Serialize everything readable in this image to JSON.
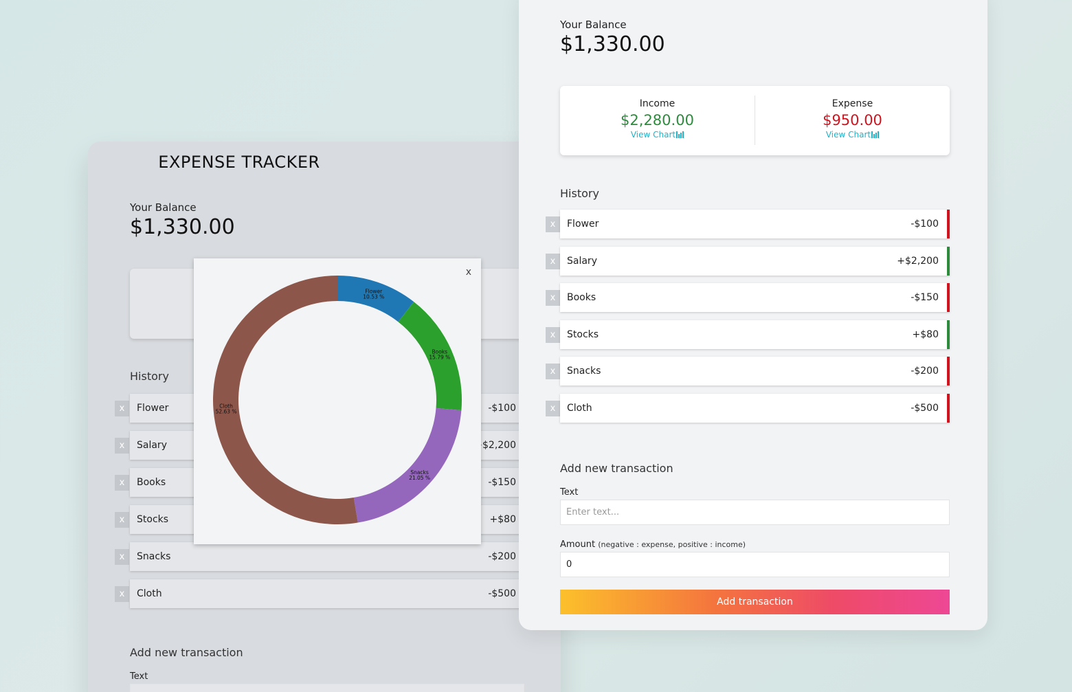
{
  "app_title": "EXPENSE TRACKER",
  "balance": {
    "label": "Your Balance",
    "value": "$1,330.00"
  },
  "income": {
    "label": "Income",
    "value": "$2,280.00",
    "link": "View Chart",
    "color": "#2e8b3e"
  },
  "expense": {
    "label": "Expense",
    "value": "$950.00",
    "link": "View Chart",
    "color": "#d0141f"
  },
  "history": {
    "title": "History",
    "delete_label": "x",
    "items": [
      {
        "text": "Flower",
        "amount": "-$100",
        "type": "expense"
      },
      {
        "text": "Salary",
        "amount": "+$2,200",
        "type": "income"
      },
      {
        "text": "Books",
        "amount": "-$150",
        "type": "expense"
      },
      {
        "text": "Stocks",
        "amount": "+$80",
        "type": "income"
      },
      {
        "text": "Snacks",
        "amount": "-$200",
        "type": "expense"
      },
      {
        "text": "Cloth",
        "amount": "-$500",
        "type": "expense"
      }
    ]
  },
  "form": {
    "title": "Add new transaction",
    "text_label": "Text",
    "text_placeholder": "Enter text...",
    "amount_label": "Amount",
    "amount_hint": "(negative : expense, positive : income)",
    "amount_value": "0",
    "submit_label": "Add transaction"
  },
  "popup": {
    "close_label": "x"
  },
  "chart_data": {
    "type": "pie",
    "donut": true,
    "categories": [
      "Flower",
      "Books",
      "Snacks",
      "Cloth"
    ],
    "values": [
      100,
      150,
      200,
      500
    ],
    "labels": [
      "10.53 %",
      "15.79 %",
      "21.05 %",
      "52.63 %"
    ],
    "colors": [
      "#1f77b4",
      "#2ca02c",
      "#9467bd",
      "#8c564b"
    ]
  }
}
